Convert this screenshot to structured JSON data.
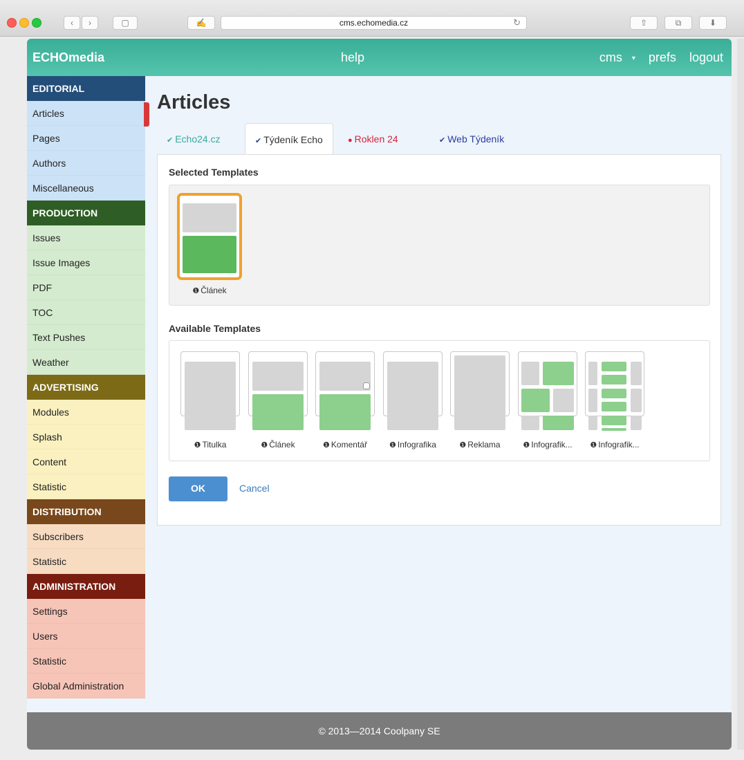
{
  "browser": {
    "url": "cms.echomedia.cz",
    "reload_icon": "reload-icon",
    "back_icon": "‹",
    "forward_icon": "›",
    "sidebar_icon": "▢",
    "bookmark_icon": "✍",
    "share_icon": "⇧",
    "tabs_icon": "⧉",
    "download_icon": "⬇"
  },
  "nav": {
    "brand": "ECHOmedia",
    "help": "help",
    "cms": "cms",
    "prefs": "prefs",
    "logout": "logout"
  },
  "sidebar": {
    "sections": [
      {
        "title": "EDITORIAL",
        "head_color": "#244e7a",
        "item_color": "#cce3f7",
        "items": [
          "Articles",
          "Pages",
          "Authors",
          "Miscellaneous"
        ]
      },
      {
        "title": "PRODUCTION",
        "head_color": "#2e5e25",
        "item_color": "#d5ebcf",
        "items": [
          "Issues",
          "Issue Images",
          "PDF",
          "TOC",
          "Text Pushes",
          "Weather"
        ]
      },
      {
        "title": "ADVERTISING",
        "head_color": "#7c6a17",
        "item_color": "#fbf1c0",
        "items": [
          "Modules",
          "Splash",
          "Content",
          "Statistic"
        ]
      },
      {
        "title": "DISTRIBUTION",
        "head_color": "#78471b",
        "item_color": "#f7dcc2",
        "items": [
          "Subscribers",
          "Statistic"
        ]
      },
      {
        "title": "ADMINISTRATION",
        "head_color": "#781d10",
        "item_color": "#f7c5b8",
        "items": [
          "Settings",
          "Users",
          "Statistic",
          "Global Administration"
        ]
      }
    ],
    "active_item": "Articles"
  },
  "main": {
    "title": "Articles",
    "tabs": [
      {
        "label": "Echo24.cz",
        "color": "#3aa9a0",
        "icon": "check-circle-icon",
        "glyph": "✔"
      },
      {
        "label": "Týdeník Echo",
        "color": "#2a3e8a",
        "icon": "check-circle-icon",
        "glyph": "✔"
      },
      {
        "label": "Roklen 24",
        "color": "#d7233f",
        "icon": "dot-icon",
        "glyph": "●"
      },
      {
        "label": "Web Týdeník",
        "color": "#2b3da3",
        "icon": "check-circle-icon",
        "glyph": "✔"
      }
    ],
    "selected_label": "Selected Templates",
    "available_label": "Available Templates",
    "selected_templates": [
      {
        "caption": "Článek"
      }
    ],
    "available_templates": [
      {
        "caption": "Titulka"
      },
      {
        "caption": "Článek"
      },
      {
        "caption": "Komentář"
      },
      {
        "caption": "Infografika"
      },
      {
        "caption": "Reklama"
      },
      {
        "caption": "Infografik..."
      },
      {
        "caption": "Infografik..."
      }
    ],
    "info_glyph": "ℹ",
    "ok_label": "OK",
    "cancel_label": "Cancel"
  },
  "footer": {
    "text": "© 2013—2014 Coolpany SE"
  }
}
